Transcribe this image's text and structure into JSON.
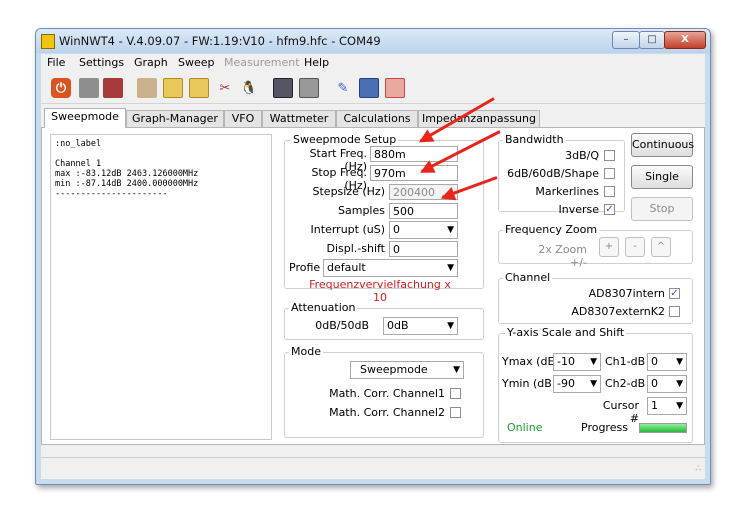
{
  "window": {
    "title": "WinNWT4 - V.4.09.07 - FW:1.19:V10 - hfm9.hfc - COM49",
    "minimize": "–",
    "maximize": "□",
    "close": "X"
  },
  "menu": [
    "File",
    "Settings",
    "Graph",
    "Sweep",
    "Measurement",
    "Help"
  ],
  "toolbar_icons": [
    "power-icon",
    "printer-icon",
    "printer-color-icon",
    "tools-icon",
    "image-icon",
    "image2-icon",
    "probe-icon",
    "tux-icon",
    "chart-icon",
    "chart2-icon",
    "pencil-icon",
    "save-icon",
    "delete-icon"
  ],
  "tabs": [
    "Sweepmode",
    "Graph-Manager",
    "VFO",
    "Wattmeter",
    "Calculations",
    "Impedanzanpassung"
  ],
  "log": {
    "text": ":no_label\n\nChannel 1\nmax :-83.12dB 2463.126000MHz\nmin :-87.14dB 2400.000000MHz\n----------------------"
  },
  "sweep_setup": {
    "title": "Sweepmode Setup",
    "start_label": "Start Freq.(Hz)",
    "start_value": "880m",
    "stop_label": "Stop Freq. (Hz)",
    "stop_value": "970m",
    "step_label": "Stepsize (Hz)",
    "step_value": "200400",
    "samples_label": "Samples",
    "samples_value": "500",
    "interrupt_label": "Interrupt (uS)",
    "interrupt_value": "0",
    "displ_label": "Displ.-shift",
    "displ_value": "0",
    "profile_label": "Profie",
    "profile_value": "default",
    "freq_note": "Frequenzvervielfachung x 10"
  },
  "attenuation": {
    "title": "Attenuation",
    "label": "0dB/50dB",
    "value": "0dB"
  },
  "mode": {
    "title": "Mode",
    "value": "Sweepmode",
    "corr1_label": "Math. Corr. Channel1",
    "corr2_label": "Math. Corr. Channel2"
  },
  "bandwidth": {
    "title": "Bandwidth",
    "q_label": "3dB/Q",
    "shape_label": "6dB/60dB/Shape",
    "marker_label": "Markerlines",
    "inverse_label": "Inverse",
    "inverse_checked": true
  },
  "buttons": {
    "continuous": "Continuous",
    "single": "Single",
    "stop": "Stop"
  },
  "zoom": {
    "title": "Frequency Zoom",
    "label": "2x Zoom +/-",
    "plus": "+",
    "minus": "-",
    "caret": "^"
  },
  "channel": {
    "title": "Channel",
    "intern_label": "AD8307intern",
    "intern_checked": true,
    "extern_label": "AD8307externK2"
  },
  "yaxis": {
    "title": "Y-axis Scale and Shift",
    "ymax_label": "Ymax (dE",
    "ymax_value": "-10",
    "ch1_label": "Ch1-dB",
    "ch1_value": "0",
    "ymin_label": "Ymin (dB",
    "ymin_value": "-90",
    "ch2_label": "Ch2-dB",
    "ch2_value": "0",
    "cursor_label": "Cursor #",
    "cursor_value": "1",
    "online": "Online",
    "progress_label": "Progress",
    "progress": 1.0
  },
  "colors": {
    "accent_red": "#e8241b",
    "online_green": "#1a9c2c",
    "note_red": "#d42020"
  }
}
